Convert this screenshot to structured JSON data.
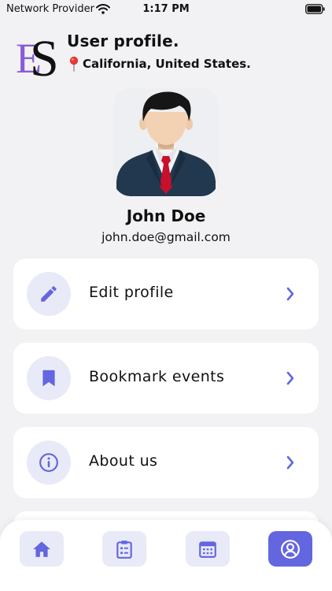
{
  "status_bar": {
    "carrier": "Network Provider",
    "time": "1:17 PM"
  },
  "header": {
    "logo_text": "ES",
    "title": "User profile.",
    "location": "California, United States."
  },
  "profile": {
    "name": "John Doe",
    "email": "john.doe@gmail.com"
  },
  "menu": [
    {
      "label": "Edit profile",
      "icon": "pencil-icon"
    },
    {
      "label": "Bookmark events",
      "icon": "bookmark-icon"
    },
    {
      "label": "About us",
      "icon": "info-icon"
    }
  ],
  "bottom_nav": [
    {
      "icon": "home-icon",
      "active": false
    },
    {
      "icon": "clipboard-list-icon",
      "active": false
    },
    {
      "icon": "calendar-icon",
      "active": false
    },
    {
      "icon": "user-icon",
      "active": true
    }
  ],
  "colors": {
    "accent": "#6366df",
    "icon_bg": "#e9eaf7",
    "background": "#f2f2f4",
    "card": "#ffffff"
  }
}
